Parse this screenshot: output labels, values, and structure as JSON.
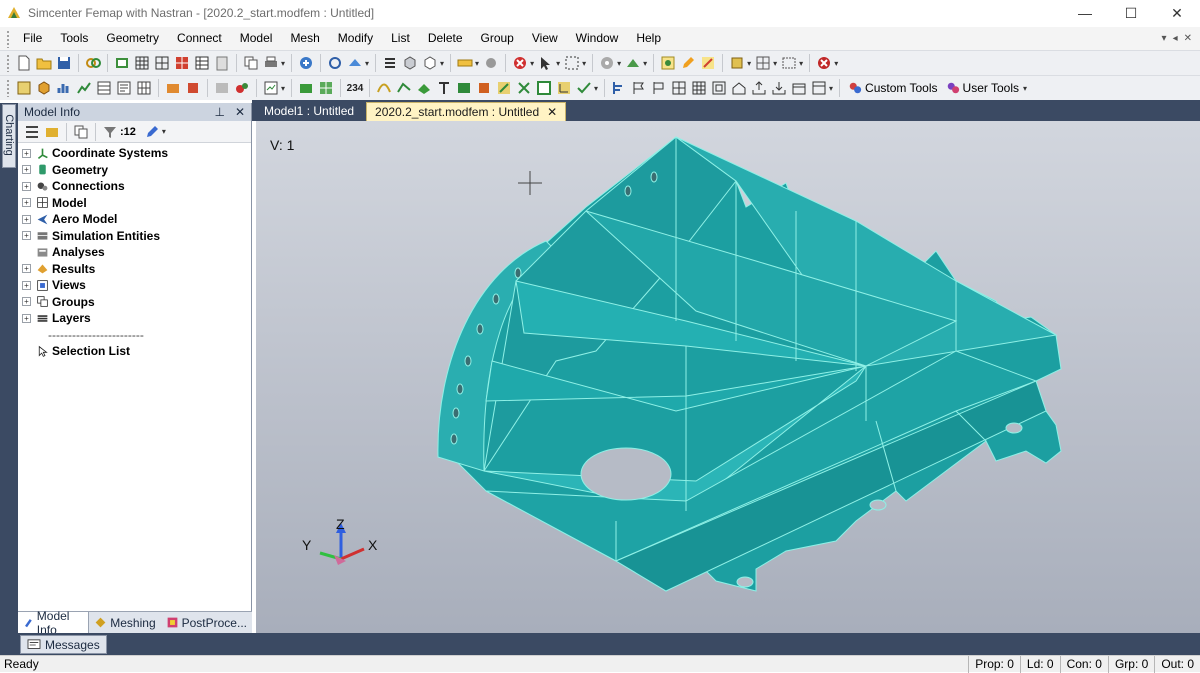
{
  "window": {
    "title": "Simcenter Femap with Nastran - [2020.2_start.modfem : Untitled]",
    "minimize": "—",
    "maximize": "☐",
    "close": "✕"
  },
  "menu": [
    "File",
    "Tools",
    "Geometry",
    "Connect",
    "Model",
    "Mesh",
    "Modify",
    "List",
    "Delete",
    "Group",
    "View",
    "Window",
    "Help"
  ],
  "menu_controls": [
    "▾",
    "◂",
    "✕"
  ],
  "toolbar": {
    "counter_label": "234",
    "custom_tools": "Custom Tools",
    "user_tools": "User Tools"
  },
  "side_strip": {
    "label": "Charting"
  },
  "model_info": {
    "title": "Model Info",
    "pin": "⊥",
    "close": "✕",
    "filter_count": ":12",
    "tree": [
      {
        "label": "Coordinate Systems",
        "icon": "coordinate-systems-icon"
      },
      {
        "label": "Geometry",
        "icon": "geometry-icon"
      },
      {
        "label": "Connections",
        "icon": "connections-icon"
      },
      {
        "label": "Model",
        "icon": "model-icon"
      },
      {
        "label": "Aero Model",
        "icon": "aero-model-icon"
      },
      {
        "label": "Simulation Entities",
        "icon": "simulation-entities-icon"
      },
      {
        "label": "Analyses",
        "icon": "analyses-icon"
      },
      {
        "label": "Results",
        "icon": "results-icon"
      },
      {
        "label": "Views",
        "icon": "views-icon"
      },
      {
        "label": "Groups",
        "icon": "groups-icon"
      },
      {
        "label": "Layers",
        "icon": "layers-icon"
      }
    ],
    "separator": "------------------------",
    "selection_list": "Selection List",
    "tabs": [
      "Model Info",
      "Meshing",
      "PostProce..."
    ]
  },
  "viewport": {
    "tabs": [
      "Model1 : Untitled",
      "2020.2_start.modfem : Untitled"
    ],
    "tab_close": "✕",
    "view_label": "V: 1",
    "axes": {
      "z": "Z",
      "y": "Y",
      "x": "X"
    }
  },
  "messages": {
    "label": "Messages"
  },
  "status": {
    "ready": "Ready",
    "cells": [
      "Prop: 0",
      "Ld: 0",
      "Con: 0",
      "Grp: 0",
      "Out: 0"
    ]
  },
  "colors": {
    "model_face": "#20a6a8",
    "model_edge": "#8ef0e6",
    "panel_dark": "#3b4a63",
    "tab_active": "#fff3c4"
  }
}
